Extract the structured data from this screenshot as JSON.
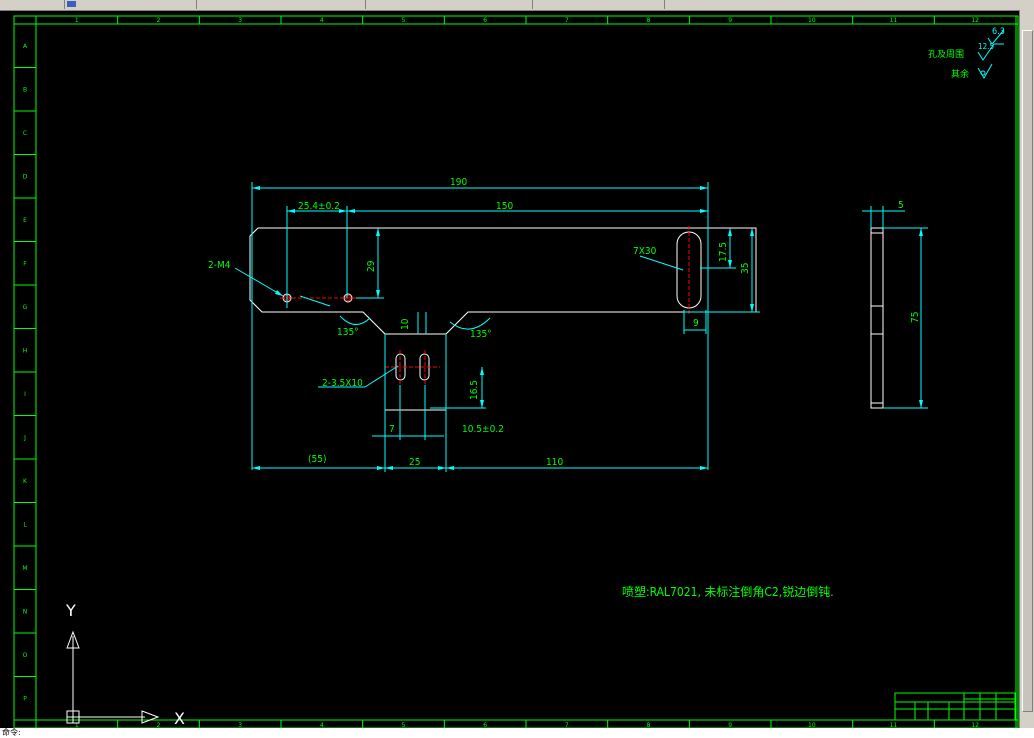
{
  "window": {
    "tabs": [
      "",
      "",
      "",
      "",
      ""
    ],
    "command_prompt": "命令:"
  },
  "drawing": {
    "frame": {
      "top_numbers": [
        "1",
        "2",
        "3",
        "4",
        "5",
        "6",
        "7",
        "8",
        "9",
        "10",
        "11",
        "12"
      ],
      "side_letters": [
        "A",
        "B",
        "C",
        "D",
        "E",
        "F",
        "G",
        "H",
        "I",
        "J",
        "K",
        "L",
        "M",
        "N",
        "O",
        "P"
      ]
    },
    "roughness": {
      "label_holes": "孔及周围",
      "value_holes": "12.5",
      "label_rest": "其余",
      "value_rest": "6.3"
    },
    "dimensions": {
      "overall_length": "190",
      "hole_to_slot": "150",
      "first_hole": "25.4±0.2",
      "hole_height": "29",
      "thread": "2-M4",
      "slot_size": "7X30",
      "slot_pos": "17.5",
      "plate_height": "35",
      "slot_offset": "9",
      "chamfer_left": "135°",
      "chamfer_right": "135°",
      "tab_height": "10",
      "small_slots": "2-3.5X10",
      "slot_depth": "16.5",
      "slot_gap": "7",
      "slot_spacing": "10.5±0.2",
      "left_ref": "(55)",
      "tab_width": "25",
      "right_len": "110",
      "thickness": "5",
      "side_height": "75"
    },
    "note": "喷塑:RAL7021, 未标注倒角C2,锐边倒钝.",
    "ucs": {
      "x": "X",
      "y": "Y"
    },
    "title_block": {
      "name": ""
    }
  },
  "colors": {
    "frame": "#00ff00",
    "dimension": "#00ffff",
    "geometry": "#ffffff",
    "centerline": "#ff0000",
    "text": "#00ff00"
  }
}
